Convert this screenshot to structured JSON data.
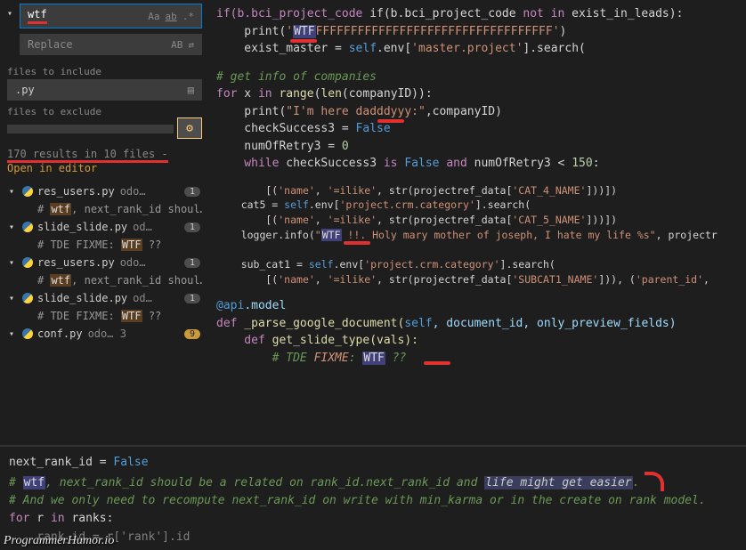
{
  "search": {
    "value": "wtf",
    "replace_placeholder": "Replace",
    "files_include_label": "files to include",
    "files_include_value": ".py",
    "files_exclude_label": "files to exclude",
    "icon_case": "Aa",
    "icon_word": "ab",
    "icon_regex": ".*",
    "icon_replace_all": "AB"
  },
  "results": {
    "summary": "170 results in 10 files -",
    "open_in_editor": "Open in editor"
  },
  "tree": [
    {
      "file": "res_users.py",
      "path": "odo…",
      "badge": "1",
      "matches": [
        {
          "pre": "# ",
          "hl": "wtf",
          "post": ", next_rank_id shoul…"
        }
      ]
    },
    {
      "file": "slide_slide.py",
      "path": "od…",
      "badge": "1",
      "matches": [
        {
          "pre": "# TDE FIXME: ",
          "hl": "WTF",
          "post": " ??"
        }
      ]
    },
    {
      "file": "res_users.py",
      "path": "odo…",
      "badge": "1",
      "matches": [
        {
          "pre": "# ",
          "hl": "wtf",
          "post": ", next_rank_id shoul…"
        }
      ]
    },
    {
      "file": "slide_slide.py",
      "path": "od…",
      "badge": "1",
      "matches": [
        {
          "pre": "# TDE FIXME: ",
          "hl": "WTF",
          "post": " ??"
        }
      ]
    },
    {
      "file": "conf.py",
      "path": "odo…  3",
      "badge": "9",
      "badge_yellow": true,
      "matches": []
    }
  ],
  "snippet1": {
    "l1_a": "if(b.bci_project_code ",
    "l1_b": "not in",
    "l1_c": " exist_in_leads):",
    "l2_a": "    print(",
    "l2_b": "'",
    "l2_hl": "WTF",
    "l2_c": "FFFFFFFFFFFFFFFFFFFFFFFFFFFFFFFFFF'",
    "l2_d": ")",
    "l3_a": "    exist_master = ",
    "l3_b": "self",
    "l3_c": ".env[",
    "l3_d": "'master.project'",
    "l3_e": "].search("
  },
  "snippet2": {
    "l1": "# get info of companies",
    "l2_a": "for",
    "l2_b": " x ",
    "l2_c": "in",
    "l2_d": " range(len(companyID)):",
    "l3_a": "    print(",
    "l3_b": "\"I'm here dadddyyy:\"",
    "l3_c": ",companyID)",
    "l4_a": "    checkSuccess3 = ",
    "l4_b": "False",
    "l5_a": "    numOfRetry3 = ",
    "l5_b": "0",
    "l6_a": "    while",
    "l6_b": " checkSuccess3 ",
    "l6_c": "is",
    "l6_d": " ",
    "l6_e": "False",
    "l6_f": " ",
    "l6_g": "and",
    "l6_h": " numOfRetry3 < ",
    "l6_i": "150",
    "l6_j": ":"
  },
  "snippet3": {
    "l1_a": "        [(",
    "l1_b": "'name'",
    "l1_c": ", ",
    "l1_d": "'=ilike'",
    "l1_e": ", str(projectref_data[",
    "l1_f": "'CAT_4_NAME'",
    "l1_g": "]))])",
    "l2_a": "    cat5 = ",
    "l2_b": "self",
    "l2_c": ".env[",
    "l2_d": "'project.crm.category'",
    "l2_e": "].search(",
    "l3_a": "        [(",
    "l3_b": "'name'",
    "l3_c": ", ",
    "l3_d": "'=ilike'",
    "l3_e": ", str(projectref_data[",
    "l3_f": "'CAT_5_NAME'",
    "l3_g": "]))])",
    "l4_a": "    logger.info(",
    "l4_b": "\"",
    "l4_hl": "WTF",
    "l4_c": " !!. Holy mary mother of joseph, I hate my life %s\"",
    "l4_d": ", projectr",
    "l5": "",
    "l6_a": "    sub_cat1 = ",
    "l6_b": "self",
    "l6_c": ".env[",
    "l6_d": "'project.crm.category'",
    "l6_e": "].search(",
    "l7_a": "        [(",
    "l7_b": "'name'",
    "l7_c": ", ",
    "l7_d": "'=ilike'",
    "l7_e": ", str(projectref_data[",
    "l7_f": "'SUBCAT1_NAME'",
    "l7_g": "])), (",
    "l7_h": "'parent_id'",
    "l7_i": ","
  },
  "snippet4": {
    "l1_a": "@api",
    "l1_b": ".model",
    "l2_a": "def",
    "l2_b": " _parse_google_document(",
    "l2_c": "self",
    "l2_d": ", document_id, only_preview_fields)",
    "l3_a": "    def",
    "l3_b": " get_slide_type(vals):",
    "l4_a": "        # TDE ",
    "l4_b": "FIXME",
    "l4_c": ": ",
    "l4_hl": "WTF",
    "l4_d": " ??"
  },
  "footer": {
    "l1_a": "next_rank_id = ",
    "l1_b": "False",
    "l2_a": "# ",
    "l2_hl": "wtf",
    "l2_b": ", next_rank_id should be a related on rank_id.next_rank_id and ",
    "l2_hl2": "life might get easier",
    "l2_c": ".",
    "l3": "# And we only need to recompute next_rank_id on write with min_karma or in the create on rank model.",
    "l4_a": "for",
    "l4_b": " r ",
    "l4_c": "in",
    "l4_d": " ranks:",
    "l5": "    rank_id = r['rank'].id"
  },
  "watermark": "ProgrammerHumor.io"
}
